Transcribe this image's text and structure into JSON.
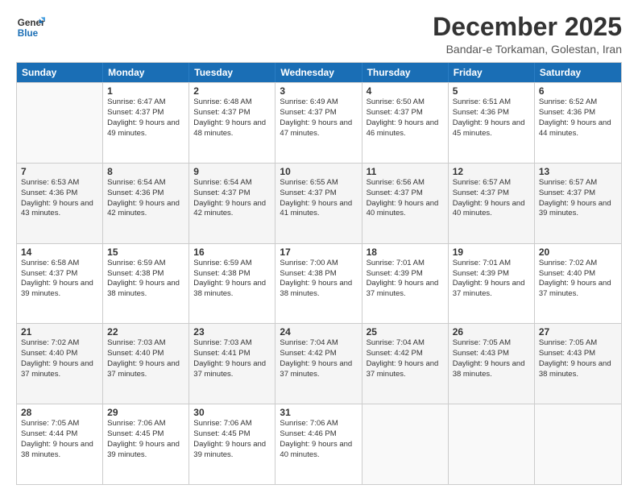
{
  "logo": {
    "line1": "General",
    "line2": "Blue"
  },
  "title": "December 2025",
  "location": "Bandar-e Torkaman, Golestan, Iran",
  "days_header": [
    "Sunday",
    "Monday",
    "Tuesday",
    "Wednesday",
    "Thursday",
    "Friday",
    "Saturday"
  ],
  "weeks": [
    [
      {
        "day": "",
        "sunrise": "",
        "sunset": "",
        "daylight": ""
      },
      {
        "day": "1",
        "sunrise": "Sunrise: 6:47 AM",
        "sunset": "Sunset: 4:37 PM",
        "daylight": "Daylight: 9 hours and 49 minutes."
      },
      {
        "day": "2",
        "sunrise": "Sunrise: 6:48 AM",
        "sunset": "Sunset: 4:37 PM",
        "daylight": "Daylight: 9 hours and 48 minutes."
      },
      {
        "day": "3",
        "sunrise": "Sunrise: 6:49 AM",
        "sunset": "Sunset: 4:37 PM",
        "daylight": "Daylight: 9 hours and 47 minutes."
      },
      {
        "day": "4",
        "sunrise": "Sunrise: 6:50 AM",
        "sunset": "Sunset: 4:37 PM",
        "daylight": "Daylight: 9 hours and 46 minutes."
      },
      {
        "day": "5",
        "sunrise": "Sunrise: 6:51 AM",
        "sunset": "Sunset: 4:36 PM",
        "daylight": "Daylight: 9 hours and 45 minutes."
      },
      {
        "day": "6",
        "sunrise": "Sunrise: 6:52 AM",
        "sunset": "Sunset: 4:36 PM",
        "daylight": "Daylight: 9 hours and 44 minutes."
      }
    ],
    [
      {
        "day": "7",
        "sunrise": "Sunrise: 6:53 AM",
        "sunset": "Sunset: 4:36 PM",
        "daylight": "Daylight: 9 hours and 43 minutes."
      },
      {
        "day": "8",
        "sunrise": "Sunrise: 6:54 AM",
        "sunset": "Sunset: 4:36 PM",
        "daylight": "Daylight: 9 hours and 42 minutes."
      },
      {
        "day": "9",
        "sunrise": "Sunrise: 6:54 AM",
        "sunset": "Sunset: 4:37 PM",
        "daylight": "Daylight: 9 hours and 42 minutes."
      },
      {
        "day": "10",
        "sunrise": "Sunrise: 6:55 AM",
        "sunset": "Sunset: 4:37 PM",
        "daylight": "Daylight: 9 hours and 41 minutes."
      },
      {
        "day": "11",
        "sunrise": "Sunrise: 6:56 AM",
        "sunset": "Sunset: 4:37 PM",
        "daylight": "Daylight: 9 hours and 40 minutes."
      },
      {
        "day": "12",
        "sunrise": "Sunrise: 6:57 AM",
        "sunset": "Sunset: 4:37 PM",
        "daylight": "Daylight: 9 hours and 40 minutes."
      },
      {
        "day": "13",
        "sunrise": "Sunrise: 6:57 AM",
        "sunset": "Sunset: 4:37 PM",
        "daylight": "Daylight: 9 hours and 39 minutes."
      }
    ],
    [
      {
        "day": "14",
        "sunrise": "Sunrise: 6:58 AM",
        "sunset": "Sunset: 4:37 PM",
        "daylight": "Daylight: 9 hours and 39 minutes."
      },
      {
        "day": "15",
        "sunrise": "Sunrise: 6:59 AM",
        "sunset": "Sunset: 4:38 PM",
        "daylight": "Daylight: 9 hours and 38 minutes."
      },
      {
        "day": "16",
        "sunrise": "Sunrise: 6:59 AM",
        "sunset": "Sunset: 4:38 PM",
        "daylight": "Daylight: 9 hours and 38 minutes."
      },
      {
        "day": "17",
        "sunrise": "Sunrise: 7:00 AM",
        "sunset": "Sunset: 4:38 PM",
        "daylight": "Daylight: 9 hours and 38 minutes."
      },
      {
        "day": "18",
        "sunrise": "Sunrise: 7:01 AM",
        "sunset": "Sunset: 4:39 PM",
        "daylight": "Daylight: 9 hours and 37 minutes."
      },
      {
        "day": "19",
        "sunrise": "Sunrise: 7:01 AM",
        "sunset": "Sunset: 4:39 PM",
        "daylight": "Daylight: 9 hours and 37 minutes."
      },
      {
        "day": "20",
        "sunrise": "Sunrise: 7:02 AM",
        "sunset": "Sunset: 4:40 PM",
        "daylight": "Daylight: 9 hours and 37 minutes."
      }
    ],
    [
      {
        "day": "21",
        "sunrise": "Sunrise: 7:02 AM",
        "sunset": "Sunset: 4:40 PM",
        "daylight": "Daylight: 9 hours and 37 minutes."
      },
      {
        "day": "22",
        "sunrise": "Sunrise: 7:03 AM",
        "sunset": "Sunset: 4:40 PM",
        "daylight": "Daylight: 9 hours and 37 minutes."
      },
      {
        "day": "23",
        "sunrise": "Sunrise: 7:03 AM",
        "sunset": "Sunset: 4:41 PM",
        "daylight": "Daylight: 9 hours and 37 minutes."
      },
      {
        "day": "24",
        "sunrise": "Sunrise: 7:04 AM",
        "sunset": "Sunset: 4:42 PM",
        "daylight": "Daylight: 9 hours and 37 minutes."
      },
      {
        "day": "25",
        "sunrise": "Sunrise: 7:04 AM",
        "sunset": "Sunset: 4:42 PM",
        "daylight": "Daylight: 9 hours and 37 minutes."
      },
      {
        "day": "26",
        "sunrise": "Sunrise: 7:05 AM",
        "sunset": "Sunset: 4:43 PM",
        "daylight": "Daylight: 9 hours and 38 minutes."
      },
      {
        "day": "27",
        "sunrise": "Sunrise: 7:05 AM",
        "sunset": "Sunset: 4:43 PM",
        "daylight": "Daylight: 9 hours and 38 minutes."
      }
    ],
    [
      {
        "day": "28",
        "sunrise": "Sunrise: 7:05 AM",
        "sunset": "Sunset: 4:44 PM",
        "daylight": "Daylight: 9 hours and 38 minutes."
      },
      {
        "day": "29",
        "sunrise": "Sunrise: 7:06 AM",
        "sunset": "Sunset: 4:45 PM",
        "daylight": "Daylight: 9 hours and 39 minutes."
      },
      {
        "day": "30",
        "sunrise": "Sunrise: 7:06 AM",
        "sunset": "Sunset: 4:45 PM",
        "daylight": "Daylight: 9 hours and 39 minutes."
      },
      {
        "day": "31",
        "sunrise": "Sunrise: 7:06 AM",
        "sunset": "Sunset: 4:46 PM",
        "daylight": "Daylight: 9 hours and 40 minutes."
      },
      {
        "day": "",
        "sunrise": "",
        "sunset": "",
        "daylight": ""
      },
      {
        "day": "",
        "sunrise": "",
        "sunset": "",
        "daylight": ""
      },
      {
        "day": "",
        "sunrise": "",
        "sunset": "",
        "daylight": ""
      }
    ]
  ]
}
